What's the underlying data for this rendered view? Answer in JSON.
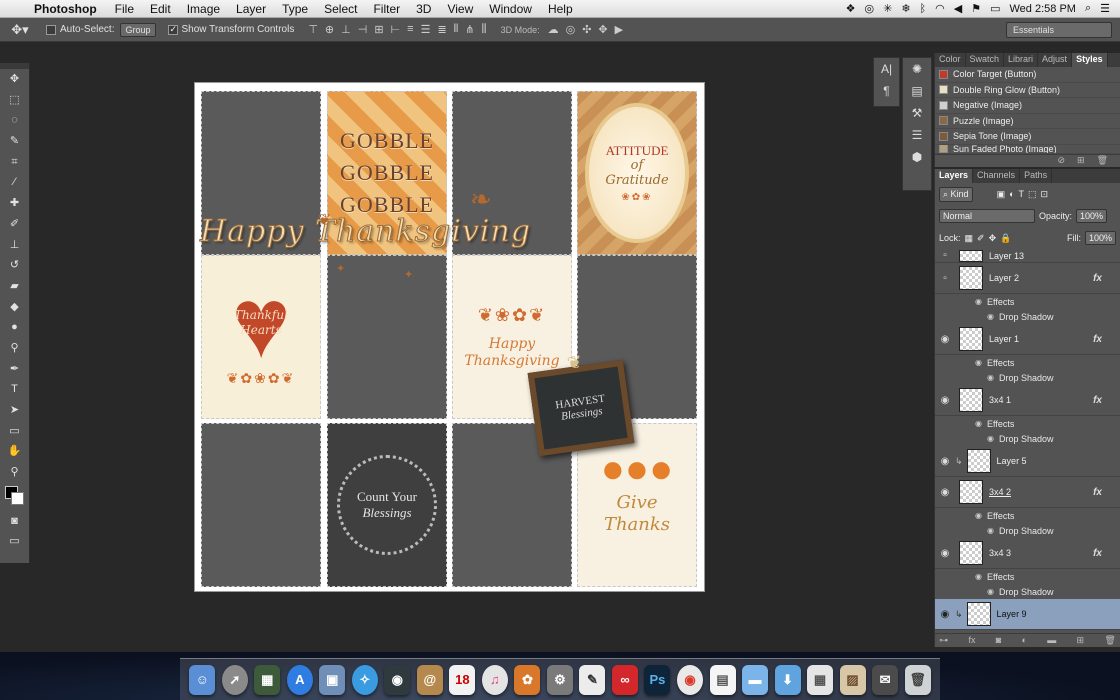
{
  "menubar": {
    "app_name": "Photoshop",
    "menus": [
      "File",
      "Edit",
      "Image",
      "Layer",
      "Type",
      "Select",
      "Filter",
      "3D",
      "View",
      "Window",
      "Help"
    ],
    "clock": "Wed 2:58 PM"
  },
  "options": {
    "auto_select_label": "Auto-Select:",
    "auto_select_value": "Group",
    "show_transform_label": "Show Transform Controls",
    "mode3d_label": "3D Mode:",
    "workspace": "Essentials"
  },
  "canvas": {
    "gobble": [
      "GOBBLE",
      "GOBBLE",
      "GOBBLE"
    ],
    "attitude": {
      "line1": "ATTITUDE",
      "line2": "of",
      "line3": "Gratitude"
    },
    "banner": "Happy Thanksgiving",
    "thankful": {
      "line1": "Thankful",
      "line2": "Hearts"
    },
    "happy": {
      "line1": "Happy",
      "line2": "Thanksgiving"
    },
    "harvest": {
      "line1": "HARVEST",
      "line2": "Blessings"
    },
    "count": {
      "line1": "Count Your",
      "line2": "Blessings"
    },
    "give": {
      "line1": "Give",
      "line2": "Thanks"
    }
  },
  "styles_panel": {
    "tabs": [
      "Color",
      "Swatch",
      "Librari",
      "Adjust",
      "Styles"
    ],
    "items": [
      "Color Target (Button)",
      "Double Ring Glow (Button)",
      "Negative (Image)",
      "Puzzle (Image)",
      "Sepia Tone (Image)",
      "Sun Faded Photo (Image)"
    ],
    "swatch_colors": [
      "#c0392b",
      "#e8e0c0",
      "#d0d0d0",
      "#8a6a44",
      "#7b5b3a",
      "#b0a080"
    ]
  },
  "layers_panel": {
    "tabs": [
      "Layers",
      "Channels",
      "Paths"
    ],
    "filter": "Kind",
    "blend_mode": "Normal",
    "opacity_label": "Opacity:",
    "opacity": "100%",
    "lock_label": "Lock:",
    "fill_label": "Fill:",
    "fill": "100%",
    "effects_label": "Effects",
    "drop_shadow_label": "Drop Shadow",
    "layers": [
      "Layer 13",
      "Layer 2",
      "Layer 1",
      "3x4 1",
      "Layer 5",
      "3x4 2",
      "3x4 3",
      "Layer 9"
    ]
  },
  "dock": {
    "apps": [
      "Finder",
      "Launchpad",
      "Mission Control",
      "App Store",
      "Preview",
      "Safari",
      "FaceTime",
      "Contacts",
      "Calendar",
      "iTunes",
      "iPhoto",
      "System Preferences",
      "TextEdit",
      "Creative Cloud",
      "Photoshop",
      "Chrome",
      "Document",
      "Folder",
      "Downloads",
      "Grid",
      "Images",
      "Stamp",
      "Trash"
    ],
    "calendar_day": "18"
  }
}
